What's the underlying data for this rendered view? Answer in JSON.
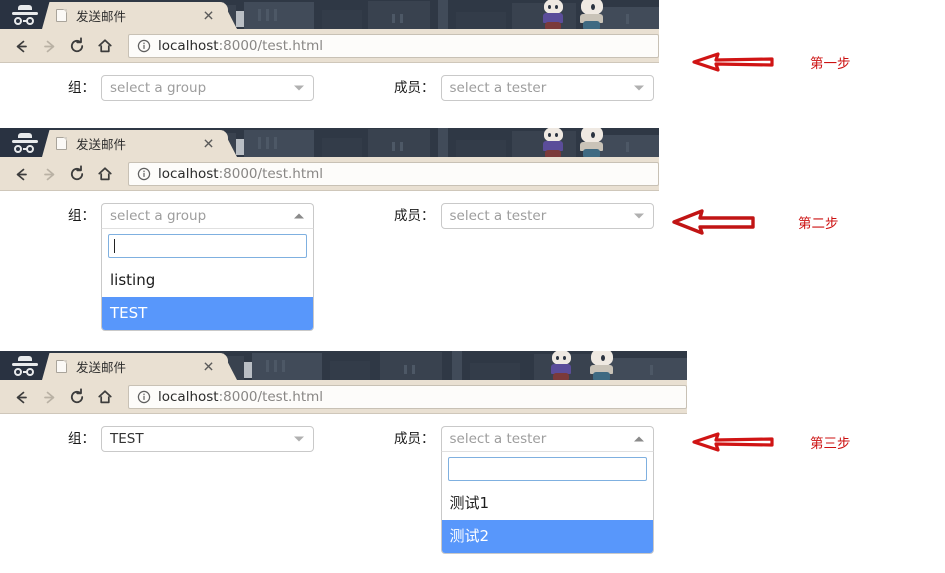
{
  "browser": {
    "tab_title": "发送邮件",
    "tab_close_label": "✕",
    "url_host": "localhost",
    "url_rest": ":8000/test.html",
    "nav": {
      "back": "back-arrow",
      "forward": "forward-arrow",
      "reload": "reload",
      "home": "home"
    },
    "incognito_label": "incognito"
  },
  "labels": {
    "group": "组：",
    "member": "成员："
  },
  "placeholders": {
    "group": "select a group",
    "member": "select a tester"
  },
  "panels": [
    {
      "id": "step-1",
      "group_value": "select a group",
      "group_is_placeholder": true,
      "group_open": false,
      "member_value": "select a tester",
      "member_is_placeholder": true,
      "member_open": false
    },
    {
      "id": "step-2",
      "group_value": "select a group",
      "group_is_placeholder": true,
      "group_open": true,
      "group_search_value": "",
      "group_options": [
        {
          "label": "listing",
          "highlighted": false
        },
        {
          "label": "TEST",
          "highlighted": true
        }
      ],
      "member_value": "select a tester",
      "member_is_placeholder": true,
      "member_open": false
    },
    {
      "id": "step-3",
      "group_value": "TEST",
      "group_is_placeholder": false,
      "group_open": false,
      "member_value": "select a tester",
      "member_is_placeholder": true,
      "member_open": true,
      "member_search_value": "",
      "member_options": [
        {
          "label": "测试1",
          "highlighted": false
        },
        {
          "label": "测试2",
          "highlighted": true
        }
      ]
    }
  ],
  "annotations": [
    {
      "text": "第一步",
      "icon": "left-arrow-icon"
    },
    {
      "text": "第二步",
      "icon": "left-arrow-icon"
    },
    {
      "text": "第三步",
      "icon": "left-arrow-icon"
    }
  ],
  "colors": {
    "accent_highlight": "#5897fb",
    "annotation_red": "#cc1111",
    "chrome_tan": "#e9e0d2",
    "theme_dark": "#2f3845"
  }
}
